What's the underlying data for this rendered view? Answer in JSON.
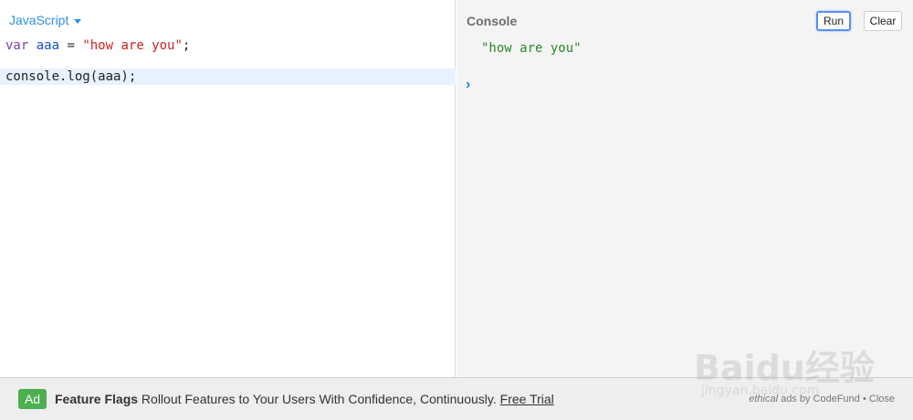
{
  "editor": {
    "language": "JavaScript",
    "code_line1": {
      "kw": "var",
      "name": "aaa",
      "op": " = ",
      "str": "\"how are you\"",
      "end": ";"
    },
    "code_line3": "console.log(aaa);"
  },
  "console": {
    "title": "Console",
    "run_label": "Run",
    "clear_label": "Clear",
    "output": "\"how are you\"",
    "prompt_symbol": "›"
  },
  "ad": {
    "badge": "Ad",
    "title": "Feature Flags",
    "text": " Rollout Features to Your Users With Confidence, Continuously. ",
    "link": "Free Trial",
    "meta_ethical": "ethical",
    "meta_rest": " ads by CodeFund • ",
    "close": "Close"
  },
  "watermark": {
    "logo": "Baidu经验",
    "url": "jingyan.baidu.com"
  },
  "colors": {
    "accent": "#2f8fe8",
    "console_bg": "#f4f4f4",
    "ad_badge": "#4caf50",
    "output_green": "#2a8a2a"
  }
}
